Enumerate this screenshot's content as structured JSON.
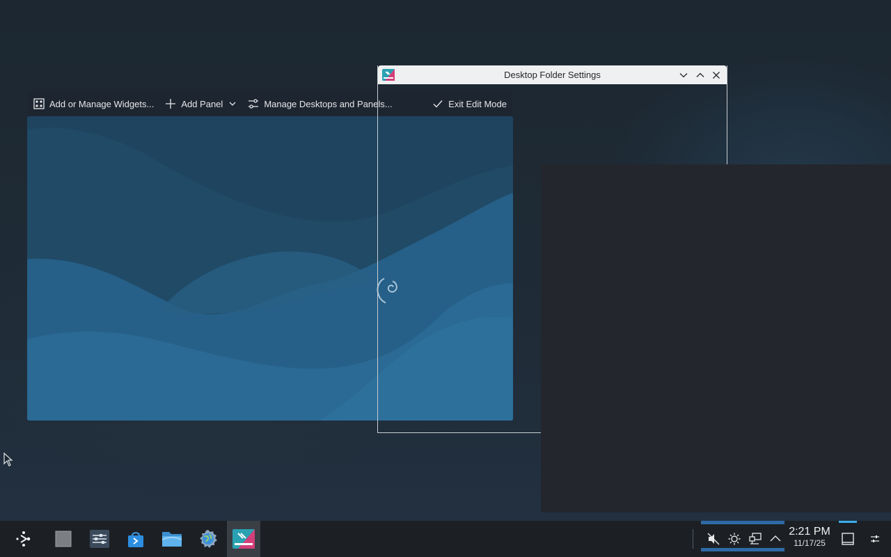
{
  "toolbar": {
    "add_widgets_label": "Add or Manage Widgets...",
    "add_panel_label": "Add Panel",
    "manage_desktops_label": "Manage Desktops and Panels...",
    "exit_edit_label": "Exit Edit Mode"
  },
  "dialog": {
    "title": "Desktop Folder Settings"
  },
  "taskbar": {
    "icons": [
      "app-launcher-icon",
      "pager-icon",
      "system-settings-icon",
      "discover-icon",
      "dolphin-file-manager-icon",
      "web-browser-icon",
      "plasma-settings-icon"
    ],
    "clock_time": "2:21 PM",
    "clock_date": "11/17/25"
  },
  "colors": {
    "accent": "#3daee9",
    "tray_highlight": "#2e6aa6",
    "wallpaper_blue": "#2c6f9c"
  }
}
